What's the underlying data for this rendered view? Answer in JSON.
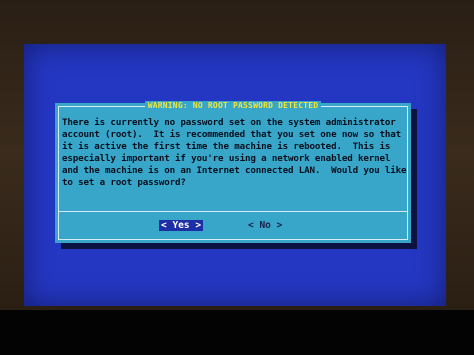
{
  "dialog": {
    "title": "WARNING: NO ROOT PASSWORD DETECTED",
    "message": "There is currently no password set on the system administrator\naccount (root).  It is recommended that you set one now so that\nit is active the first time the machine is rebooted.  This is\nespecially important if you're using a network enabled kernel\nand the machine is on an Internet connected LAN.  Would you like\nto set a root password?",
    "yes_button": "< Yes >",
    "no_button": "< No >"
  },
  "colors": {
    "screen_background": "#2437c3",
    "dialog_background": "#37a6c8",
    "title_text": "#f1e63a",
    "selected_button": "#1d2fa6"
  }
}
